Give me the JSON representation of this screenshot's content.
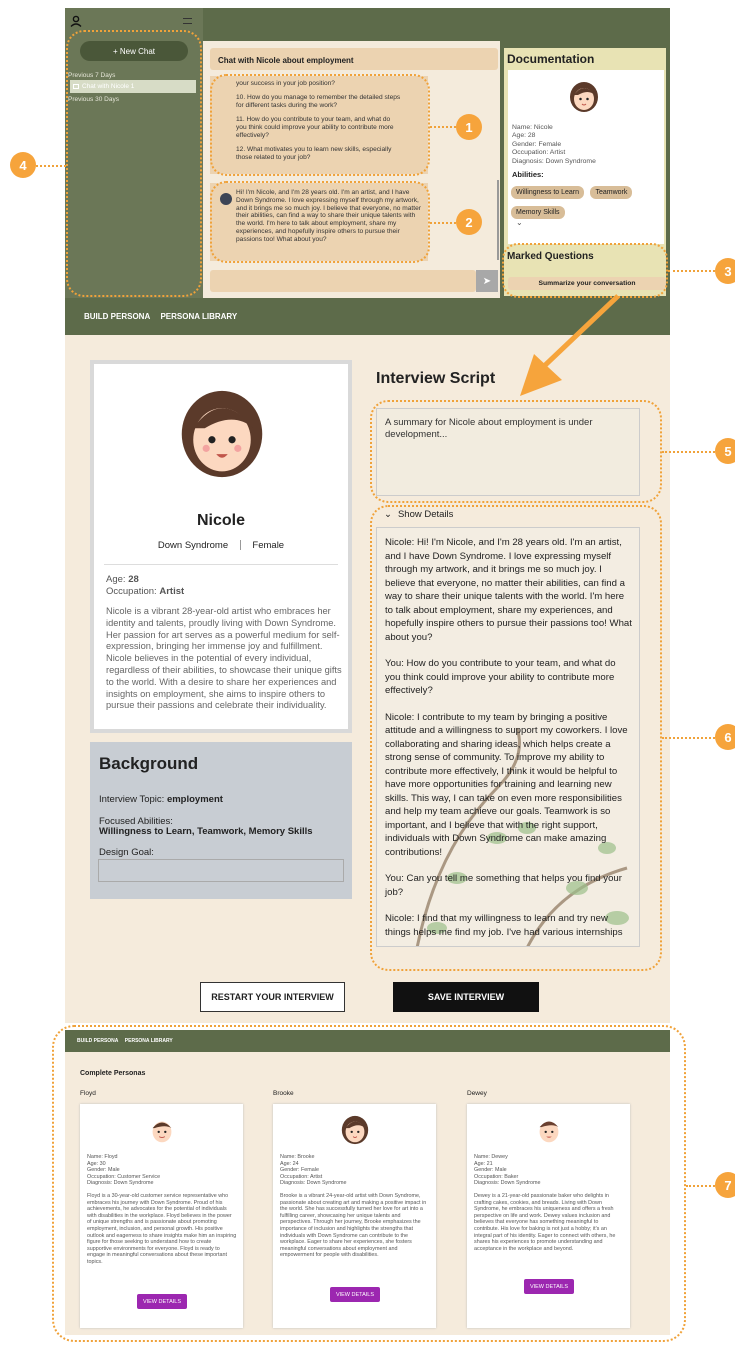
{
  "chat_app": {
    "new_chat": "+ New Chat",
    "prev7": "Previous 7 Days",
    "chat_item": "Chat with Nicole 1",
    "prev30": "Previous 30 Days",
    "chat_title": "Chat with Nicole about employment",
    "q_prefix": "your success in your job position?",
    "q10": "10. How do you manage to remember the detailed steps for different tasks during the work?",
    "q11": "11. How do you contribute to your team, and what do you think could improve your ability to contribute more effectively?",
    "q12": "12. What motivates you to learn new skills, especially those related to your job?",
    "nicole_msg": "Hi! I'm Nicole, and I'm 28 years old. I'm an artist, and I have Down Syndrome. I love expressing myself through my artwork, and it brings me so much joy. I believe that everyone, no matter their abilities, can find a way to share their unique talents with the world. I'm here to talk about employment, share my experiences, and hopefully inspire others to pursue their passions too! What about you?",
    "doc_title": "Documentation",
    "doc_name": "Name: Nicole",
    "doc_age": "Age: 28",
    "doc_gender": "Gender: Female",
    "doc_occupation": "Occupation: Artist",
    "doc_diagnosis": "Diagnosis: Down Syndrome",
    "abilities_label": "Abilities:",
    "abilities": [
      "Willingness to Learn",
      "Teamwork",
      "Memory Skills"
    ],
    "marked_title": "Marked Questions",
    "summarize_btn": "Summarize your conversation"
  },
  "nav": {
    "build": "BUILD PERSONA",
    "library": "PERSONA LIBRARY"
  },
  "persona": {
    "name": "Nicole",
    "diagnosis": "Down Syndrome",
    "gender": "Female",
    "age_label": "Age: ",
    "age": "28",
    "occ_label": "Occupation: ",
    "occupation": "Artist",
    "bio": "Nicole is a vibrant 28-year-old artist who embraces her identity and talents, proudly living with Down Syndrome. Her passion for art serves as a powerful medium for self-expression, bringing her immense joy and fulfillment. Nicole believes in the potential of every individual, regardless of their abilities, to showcase their unique gifts to the world. With a desire to share her experiences and insights on employment, she aims to inspire others to pursue their passions and celebrate their individuality."
  },
  "background": {
    "title": "Background",
    "topic_label": "Interview Topic: ",
    "topic": "employment",
    "abilities_label": "Focused Abilities:",
    "abilities": "Willingness to Learn, Teamwork, Memory Skills",
    "goal_label": "Design Goal:",
    "goal_value": ""
  },
  "script": {
    "title": "Interview Script",
    "summary": "A summary for Nicole about employment is under development...",
    "show_details": "Show Details",
    "p1": "Nicole: Hi! I'm Nicole, and I'm 28 years old. I'm an artist, and I have Down Syndrome. I love expressing myself through my artwork, and it brings me so much joy. I believe that everyone, no matter their abilities, can find a way to share their unique talents with the world. I'm here to talk about employment, share my experiences, and hopefully inspire others to pursue their passions too! What about you?",
    "p2": "You:  How do you contribute to your team, and what do you think could improve your ability to contribute more effectively?",
    "p3": "Nicole: I contribute to my team by bringing a positive attitude and a willingness to support my coworkers. I love collaborating and sharing ideas, which helps create a strong sense of community. To improve my ability to contribute more effectively, I think it would be helpful to have more opportunities for training and learning new skills. This way, I can take on even more responsibilities and help my team achieve our goals. Teamwork is so important, and I believe that with the right support, individuals with Down Syndrome can make amazing contributions!",
    "p4": "You: Can you tell me something that helps you find your job?",
    "p5": "Nicole: I find that my willingness to learn and try new things helps me find my job. I've had various internships"
  },
  "buttons": {
    "restart": "RESTART YOUR INTERVIEW",
    "save": "SAVE INTERVIEW"
  },
  "library": {
    "title": "Complete Personas",
    "view": "VIEW DETAILS",
    "cards": [
      {
        "heading": "Floyd",
        "name": "Name: Floyd",
        "age": "Age: 30",
        "gender": "Gender: Male",
        "occ": "Occupation: Customer Service",
        "diag": "Diagnosis: Down Syndrome",
        "bio": "Floyd is a 30-year-old customer service representative who embraces his journey with Down Syndrome. Proud of his achievements, he advocates for the potential of individuals with disabilities in the workplace. Floyd believes in the power of unique strengths and is passionate about promoting employment, inclusion, and personal growth. His positive outlook and eagerness to share insights make him an inspiring figure for those seeking to understand how to create supportive environments for everyone. Floyd is ready to engage in meaningful conversations about these important topics."
      },
      {
        "heading": "Brooke",
        "name": "Name: Brooke",
        "age": "Age: 24",
        "gender": "Gender: Female",
        "occ": "Occupation: Artist",
        "diag": "Diagnosis: Down Syndrome",
        "bio": "Brooke is a vibrant 24-year-old artist with Down Syndrome, passionate about creating art and making a positive impact in the world. She has successfully turned her love for art into a fulfilling career, showcasing her unique talents and perspectives. Through her journey, Brooke emphasizes the importance of inclusion and highlights the strengths that individuals with Down Syndrome can contribute to the workplace. Eager to share her experiences, she fosters meaningful conversations about employment and empowerment for people with disabilities."
      },
      {
        "heading": "Dewey",
        "name": "Name: Dewey",
        "age": "Age: 21",
        "gender": "Gender: Male",
        "occ": "Occupation: Baker",
        "diag": "Diagnosis: Down Syndrome",
        "bio": "Dewey is a 21-year-old passionate baker who delights in crafting cakes, cookies, and breads. Living with Down Syndrome, he embraces his uniqueness and offers a fresh perspective on life and work. Dewey values inclusion and believes that everyone has something meaningful to contribute. His love for baking is not just a hobby; it's an integral part of his identity. Eager to connect with others, he shares his experiences to promote understanding and acceptance in the workplace and beyond."
      }
    ]
  },
  "callouts": [
    "1",
    "2",
    "3",
    "4",
    "5",
    "6",
    "7"
  ],
  "colors": {
    "accent": "#f6a43c",
    "olive": "#5d6b4a",
    "cream": "#f3eadb",
    "purple": "#9c27b0"
  }
}
